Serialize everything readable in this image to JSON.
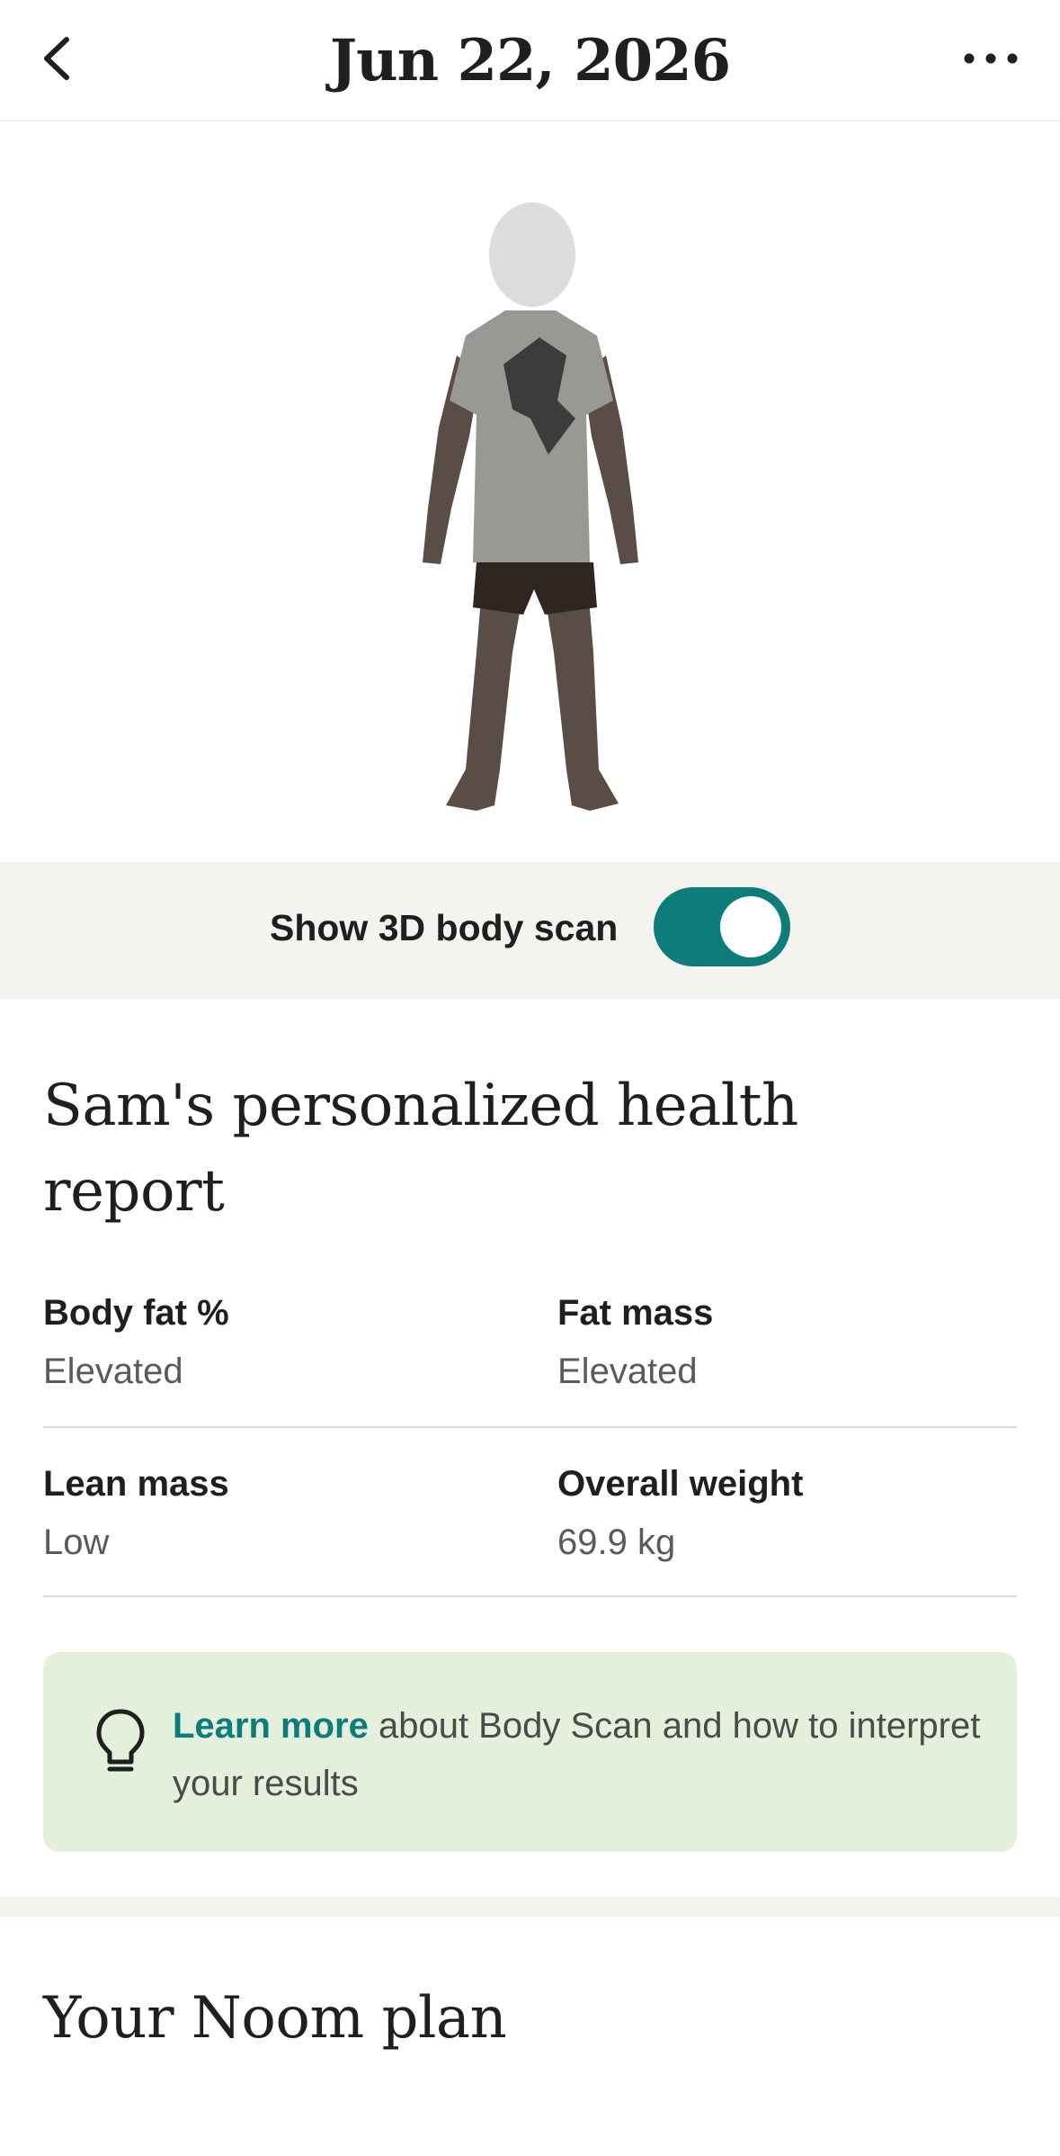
{
  "header": {
    "title": "Jun 22, 2026",
    "back_icon": "chevron-left-icon",
    "more_icon": "more-horizontal-icon"
  },
  "scan": {
    "toggle_label": "Show 3D body scan",
    "toggle_on": true,
    "accent_color": "#0e7c7b"
  },
  "report": {
    "title": "Sam's personalized health report",
    "metrics": [
      {
        "label": "Body fat %",
        "value": "Elevated"
      },
      {
        "label": "Fat mass",
        "value": "Elevated"
      },
      {
        "label": "Lean mass",
        "value": "Low"
      },
      {
        "label": "Overall weight",
        "value": "69.9 kg"
      }
    ]
  },
  "tip": {
    "icon": "lightbulb-icon",
    "link_text": "Learn more",
    "text": " about Body Scan and how to interpret your results",
    "background": "#e4efdc"
  },
  "plan": {
    "title": "Your Noom plan"
  }
}
